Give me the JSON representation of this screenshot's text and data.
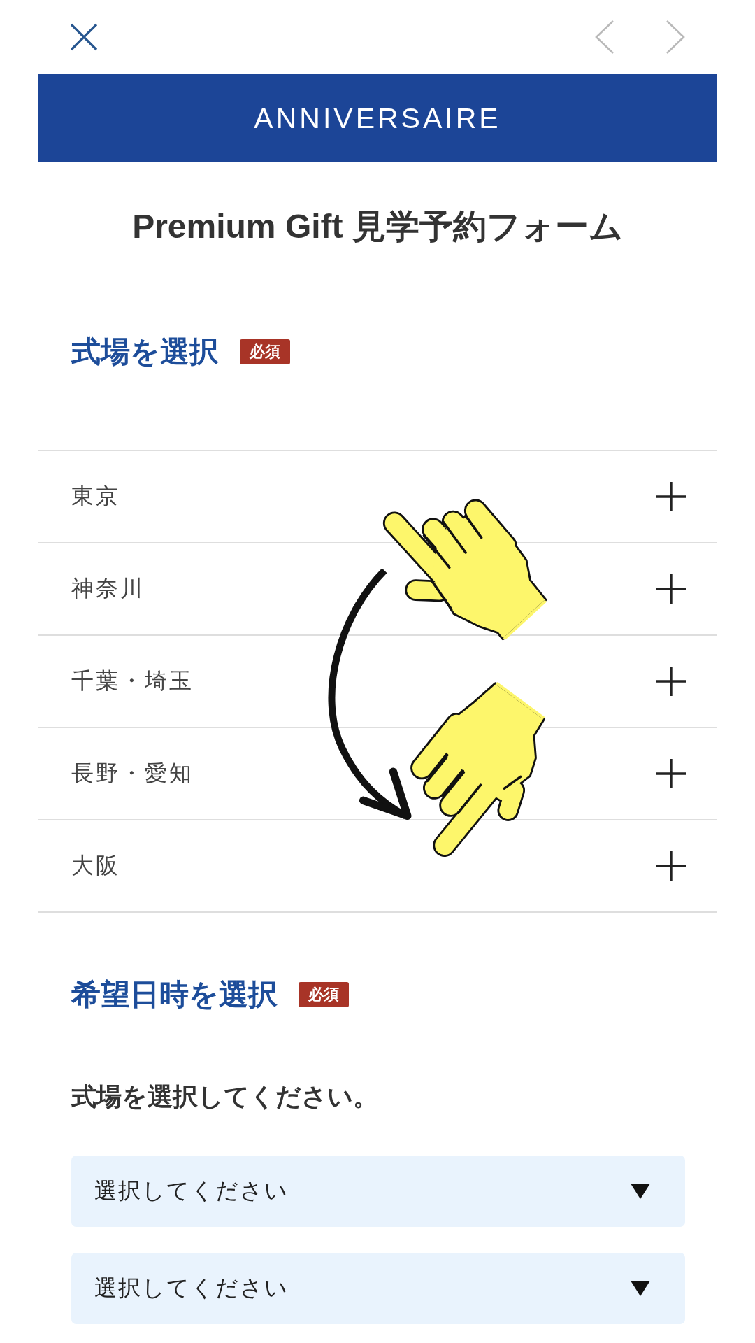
{
  "navigation": {
    "previous": {
      "disabled": true
    },
    "next": {
      "disabled": true
    }
  },
  "header": {
    "logo": "ANNIVERSAIRE"
  },
  "title": "Premium Gift 見学予約フォーム",
  "venue_section": {
    "heading": "式場を選択",
    "badge": "必須",
    "regions": [
      {
        "label": "東京",
        "expanded": false
      },
      {
        "label": "神奈川",
        "expanded": false
      },
      {
        "label": "千葉・埼玉",
        "expanded": false
      },
      {
        "label": "長野・愛知",
        "expanded": false
      },
      {
        "label": "大阪",
        "expanded": false
      }
    ]
  },
  "datetime_section": {
    "heading": "希望日時を選択",
    "badge": "必須",
    "instruction": "式場を選択してください。",
    "selects": [
      {
        "placeholder": "選択してください"
      },
      {
        "placeholder": "選択してください"
      }
    ]
  }
}
